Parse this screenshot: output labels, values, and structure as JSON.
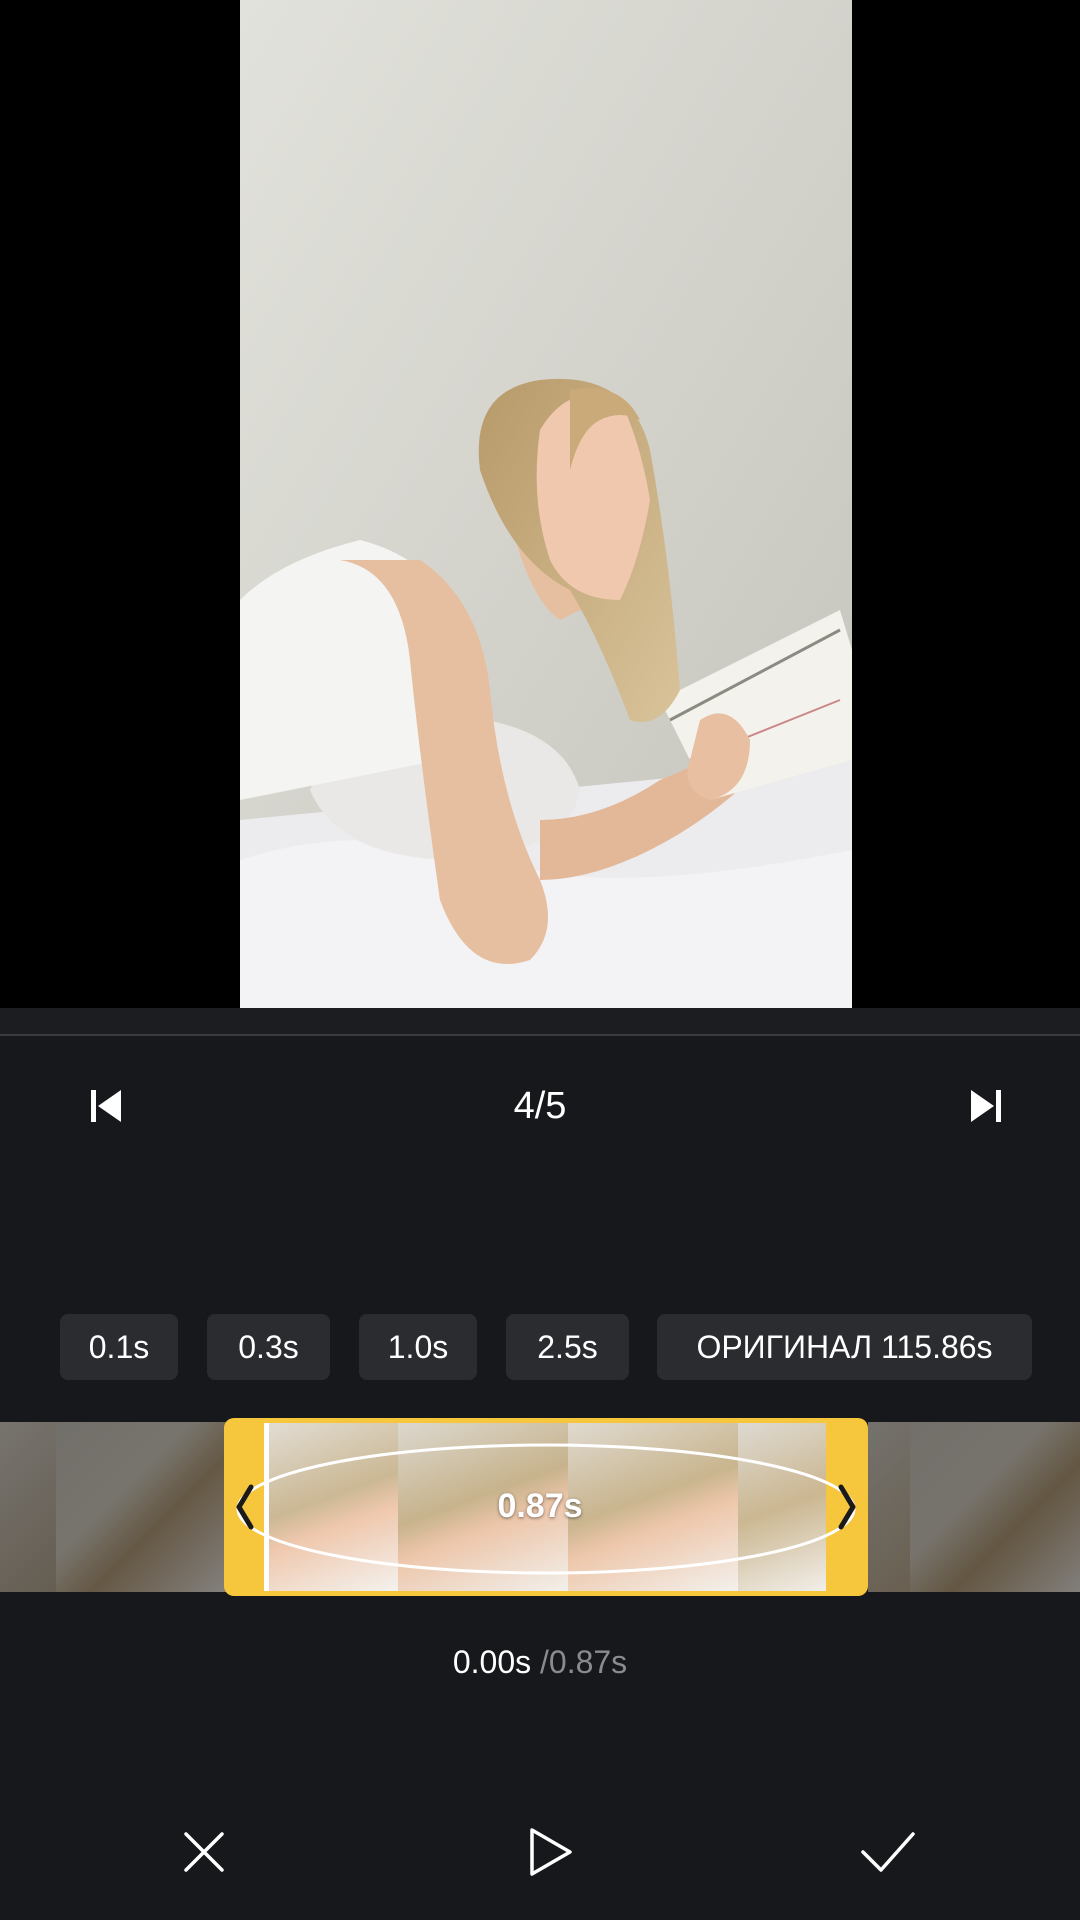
{
  "preview": {
    "icon": "video-frame-person-reading"
  },
  "navigation": {
    "prev_icon": "skip-previous-icon",
    "counter": "4/5",
    "next_icon": "skip-next-icon"
  },
  "duration_options": [
    {
      "label": "0.1s"
    },
    {
      "label": "0.3s"
    },
    {
      "label": "1.0s"
    },
    {
      "label": "2.5s"
    },
    {
      "label": "ОРИГИНАЛ 115.86s"
    }
  ],
  "timeline": {
    "clip_duration": "0.87s",
    "playhead_progress": 0
  },
  "time_readout": {
    "current": "0.00s",
    "separator": "/",
    "total": "0.87s"
  },
  "controls": {
    "cancel_icon": "close-icon",
    "play_icon": "play-icon",
    "confirm_icon": "checkmark-icon"
  },
  "colors": {
    "background": "#17181c",
    "accent": "#f6c63c",
    "chip": "#2b2c30",
    "text": "#ffffff",
    "muted": "#8a8b90"
  }
}
